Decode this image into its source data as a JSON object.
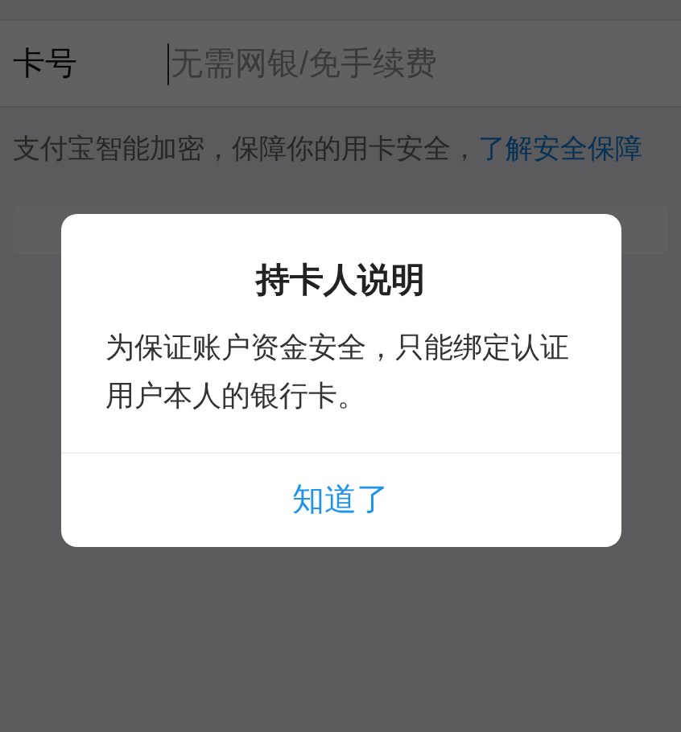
{
  "card_field": {
    "label": "卡号",
    "placeholder": "无需网银/免手续费"
  },
  "notice": {
    "text": "支付宝智能加密，保障你的用卡安全，",
    "link": "了解安全保障"
  },
  "dialog": {
    "title": "持卡人说明",
    "message": "为保证账户资金安全，只能绑定认证用户本人的银行卡。",
    "button": "知道了"
  }
}
